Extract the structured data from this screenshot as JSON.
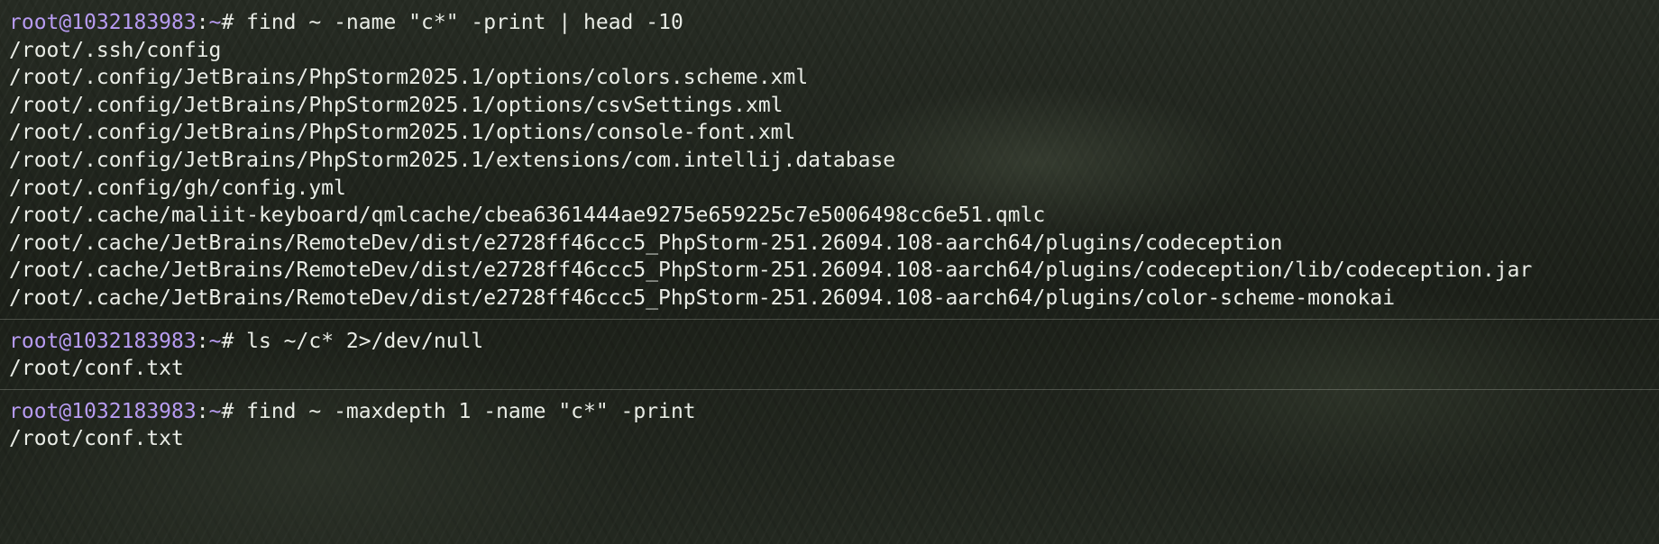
{
  "prompt": {
    "user_host": "root@1032183983",
    "colon": ":",
    "path": "~",
    "symbol": "# "
  },
  "blocks": [
    {
      "command": "find ~ -name \"c*\" -print | head -10",
      "output": [
        "/root/.ssh/config",
        "/root/.config/JetBrains/PhpStorm2025.1/options/colors.scheme.xml",
        "/root/.config/JetBrains/PhpStorm2025.1/options/csvSettings.xml",
        "/root/.config/JetBrains/PhpStorm2025.1/options/console-font.xml",
        "/root/.config/JetBrains/PhpStorm2025.1/extensions/com.intellij.database",
        "/root/.config/gh/config.yml",
        "/root/.cache/maliit-keyboard/qmlcache/cbea6361444ae9275e659225c7e5006498cc6e51.qmlc",
        "/root/.cache/JetBrains/RemoteDev/dist/e2728ff46ccc5_PhpStorm-251.26094.108-aarch64/plugins/codeception",
        "/root/.cache/JetBrains/RemoteDev/dist/e2728ff46ccc5_PhpStorm-251.26094.108-aarch64/plugins/codeception/lib/codeception.jar",
        "/root/.cache/JetBrains/RemoteDev/dist/e2728ff46ccc5_PhpStorm-251.26094.108-aarch64/plugins/color-scheme-monokai"
      ]
    },
    {
      "command": "ls ~/c* 2>/dev/null",
      "output": [
        "/root/conf.txt"
      ]
    },
    {
      "command": "find ~ -maxdepth 1 -name \"c*\" -print",
      "output": [
        "/root/conf.txt"
      ]
    }
  ]
}
